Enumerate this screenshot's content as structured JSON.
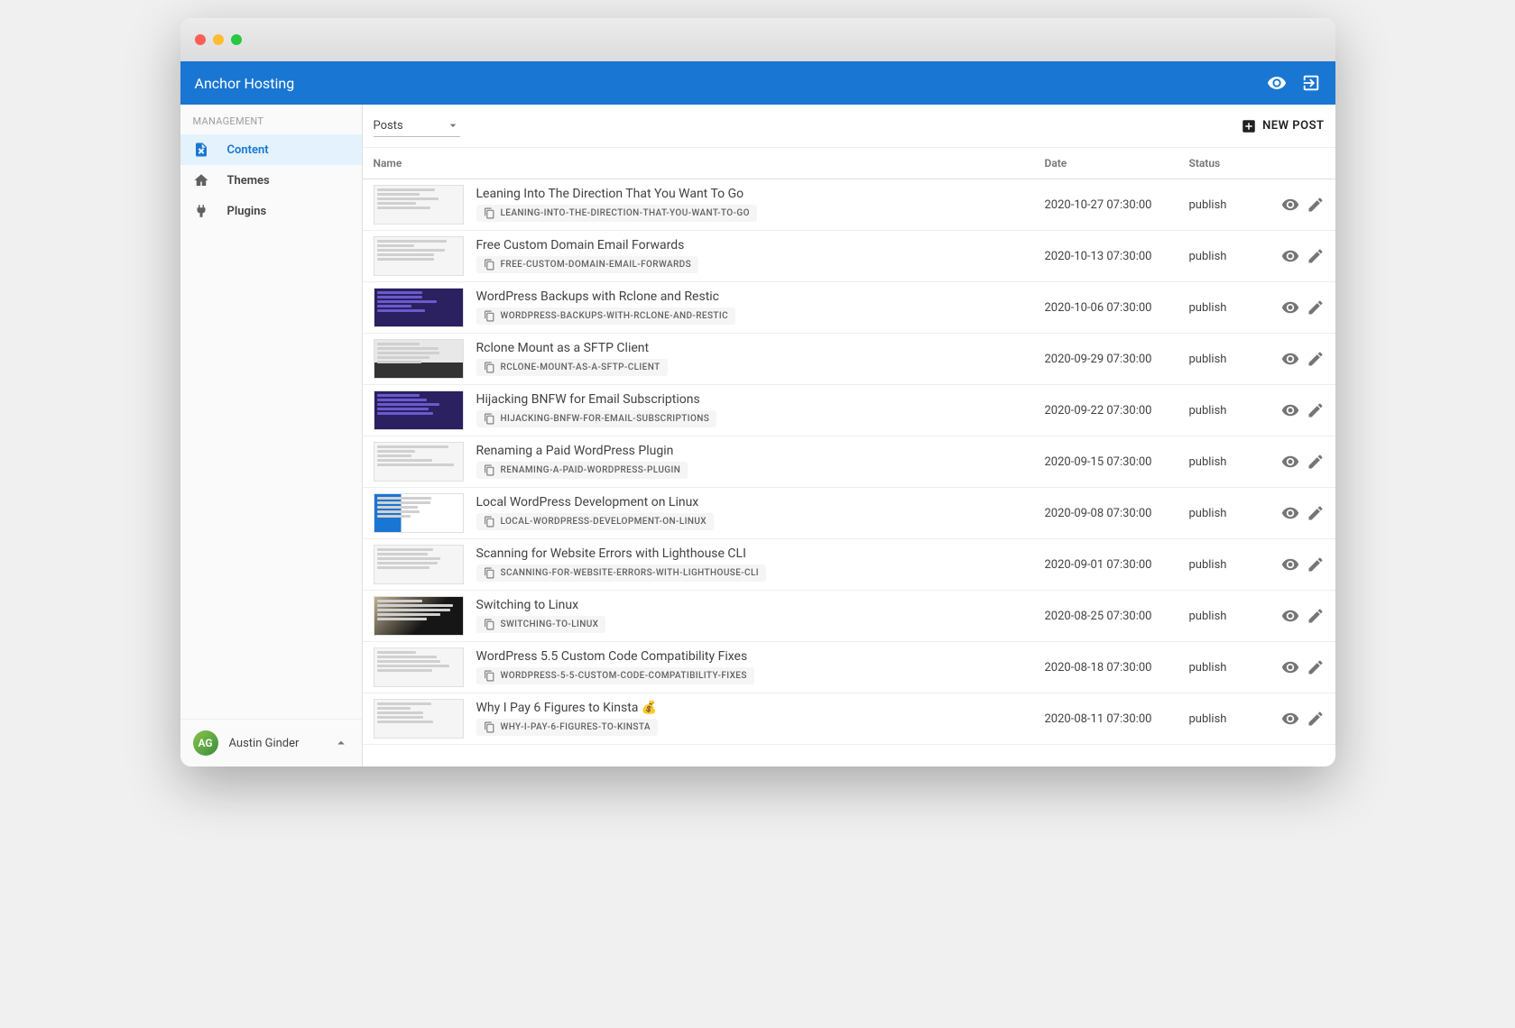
{
  "header": {
    "title": "Anchor Hosting"
  },
  "sidebar": {
    "section_label": "MANAGEMENT",
    "items": [
      {
        "label": "Content",
        "active": true
      },
      {
        "label": "Themes",
        "active": false
      },
      {
        "label": "Plugins",
        "active": false
      }
    ]
  },
  "user": {
    "name": "Austin Ginder"
  },
  "toolbar": {
    "select_value": "Posts",
    "new_post_label": "NEW POST"
  },
  "columns": {
    "name": "Name",
    "date": "Date",
    "status": "Status"
  },
  "posts": [
    {
      "title": "Leaning Into The Direction That You Want To Go",
      "slug": "LEANING-INTO-THE-DIRECTION-THAT-YOU-WANT-TO-GO",
      "date": "2020-10-27 07:30:00",
      "status": "publish",
      "thumb": "light"
    },
    {
      "title": "Free Custom Domain Email Forwards",
      "slug": "FREE-CUSTOM-DOMAIN-EMAIL-FORWARDS",
      "date": "2020-10-13 07:30:00",
      "status": "publish",
      "thumb": "light"
    },
    {
      "title": "WordPress Backups with Rclone and Restic",
      "slug": "WORDPRESS-BACKUPS-WITH-RCLONE-AND-RESTIC",
      "date": "2020-10-06 07:30:00",
      "status": "publish",
      "thumb": "dark"
    },
    {
      "title": "Rclone Mount as a SFTP Client",
      "slug": "RCLONE-MOUNT-AS-A-SFTP-CLIENT",
      "date": "2020-09-29 07:30:00",
      "status": "publish",
      "thumb": "desk"
    },
    {
      "title": "Hijacking BNFW for Email Subscriptions",
      "slug": "HIJACKING-BNFW-FOR-EMAIL-SUBSCRIPTIONS",
      "date": "2020-09-22 07:30:00",
      "status": "publish",
      "thumb": "dark"
    },
    {
      "title": "Renaming a Paid WordPress Plugin",
      "slug": "RENAMING-A-PAID-WORDPRESS-PLUGIN",
      "date": "2020-09-15 07:30:00",
      "status": "publish",
      "thumb": "light"
    },
    {
      "title": "Local WordPress Development on Linux",
      "slug": "LOCAL-WORDPRESS-DEVELOPMENT-ON-LINUX",
      "date": "2020-09-08 07:30:00",
      "status": "publish",
      "thumb": "screen"
    },
    {
      "title": "Scanning for Website Errors with Lighthouse CLI",
      "slug": "SCANNING-FOR-WEBSITE-ERRORS-WITH-LIGHTHOUSE-CLI",
      "date": "2020-09-01 07:30:00",
      "status": "publish",
      "thumb": "light"
    },
    {
      "title": "Switching to Linux",
      "slug": "SWITCHING-TO-LINUX",
      "date": "2020-08-25 07:30:00",
      "status": "publish",
      "thumb": "photo"
    },
    {
      "title": "WordPress 5.5 Custom Code Compatibility Fixes",
      "slug": "WORDPRESS-5-5-CUSTOM-CODE-COMPATIBILITY-FIXES",
      "date": "2020-08-18 07:30:00",
      "status": "publish",
      "thumb": "light"
    },
    {
      "title": "Why I Pay 6 Figures to Kinsta 💰",
      "slug": "WHY-I-PAY-6-FIGURES-TO-KINSTA",
      "date": "2020-08-11 07:30:00",
      "status": "publish",
      "thumb": "light"
    }
  ]
}
